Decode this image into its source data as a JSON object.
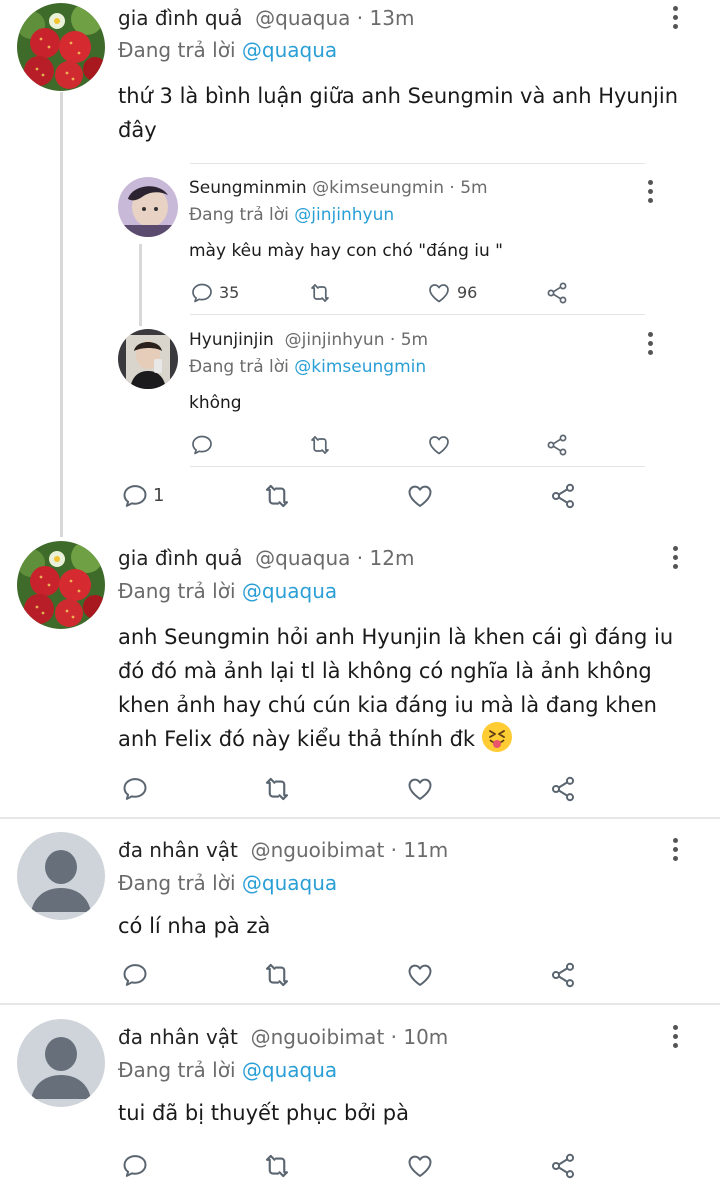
{
  "colors": {
    "mention": "#2a9fd6",
    "divider": "#e6e6e6",
    "icon": "#5a6570"
  },
  "comments": [
    {
      "name": "gia đình quả",
      "handle": "@quaqua",
      "time": "13m",
      "reply_prefix": "Đang trả lời",
      "reply_to": "@quaqua",
      "text_lines": [
        "thứ 3 là bình luận giữa anh Seungmin và anh Hyunjin",
        "đây"
      ],
      "reply_count": "1",
      "replies": [
        {
          "name": "Seungminmin",
          "handle": "@kimseungmin",
          "time": "5m",
          "reply_prefix": "Đang trả lời",
          "reply_to": "@jinjinhyun",
          "text": "mày kêu mày hay con chó \"đáng iu \"",
          "reply_count": "35",
          "like_count": "96"
        },
        {
          "name": "Hyunjinjin",
          "handle": "@jinjinhyun",
          "time": "5m",
          "reply_prefix": "Đang trả lời",
          "reply_to": "@kimseungmin",
          "text": "không"
        }
      ]
    },
    {
      "name": "gia đình quả",
      "handle": "@quaqua",
      "time": "12m",
      "reply_prefix": "Đang trả lời",
      "reply_to": "@quaqua",
      "text_lines": [
        "anh Seungmin hỏi anh Hyunjin là khen cái gì đáng iu",
        "đó đó mà ảnh lại tl là không có nghĩa là ảnh không",
        "khen ảnh hay chú cún kia đáng iu mà là đang khen",
        "anh Felix đó này kiểu thả thính đk"
      ],
      "emoji": "squinting-tongue-emoji"
    },
    {
      "name": "đa nhân vật",
      "handle": "@nguoibimat",
      "time": "11m",
      "reply_prefix": "Đang trả lời",
      "reply_to": "@quaqua",
      "text_lines": [
        "có lí nha pà zà"
      ]
    },
    {
      "name": "đa nhân vật",
      "handle": "@nguoibimat",
      "time": "10m",
      "reply_prefix": "Đang trả lời",
      "reply_to": "@quaqua",
      "text_lines": [
        "tui đã bị thuyết phục bởi pà"
      ]
    }
  ]
}
